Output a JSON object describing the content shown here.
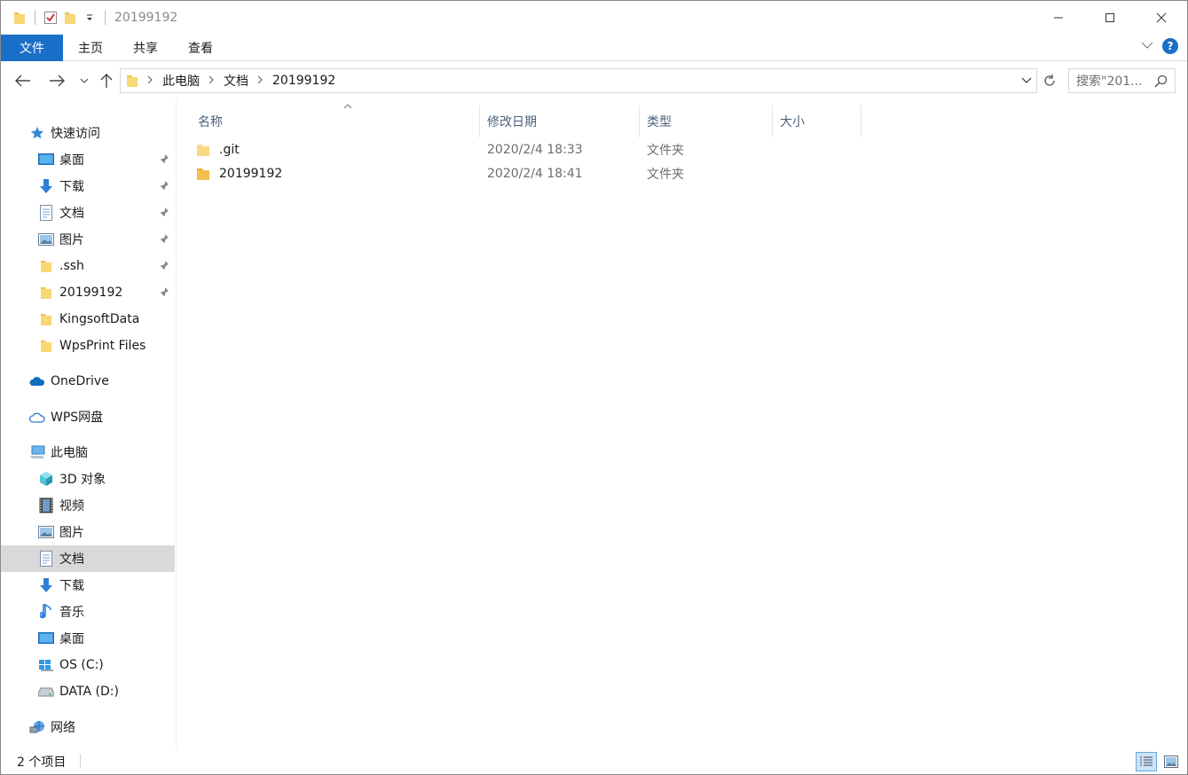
{
  "window": {
    "title": "20199192"
  },
  "ribbon": {
    "tabs": [
      "文件",
      "主页",
      "共享",
      "查看"
    ]
  },
  "address": {
    "segments": [
      "此电脑",
      "文档",
      "20199192"
    ],
    "search_placeholder": "搜索\"201..."
  },
  "sidebar": {
    "quick_access": "快速访问",
    "quick_items": [
      "桌面",
      "下载",
      "文档",
      "图片",
      ".ssh",
      "20199192",
      "KingsoftData",
      "WpsPrint Files"
    ],
    "onedrive": "OneDrive",
    "wps": "WPS网盘",
    "this_pc": "此电脑",
    "pc_items": [
      "3D 对象",
      "视频",
      "图片",
      "文档",
      "下载",
      "音乐",
      "桌面",
      "OS (C:)",
      "DATA (D:)"
    ],
    "network": "网络"
  },
  "columns": [
    "名称",
    "修改日期",
    "类型",
    "大小"
  ],
  "files": [
    {
      "name": ".git",
      "date": "2020/2/4 18:33",
      "type": "文件夹"
    },
    {
      "name": "20199192",
      "date": "2020/2/4 18:41",
      "type": "文件夹"
    }
  ],
  "status": {
    "count": "2 个项目"
  },
  "colors": {
    "accent": "#1a6fc9",
    "folder": "#f3c04d",
    "selected": "#d9d9d9"
  }
}
